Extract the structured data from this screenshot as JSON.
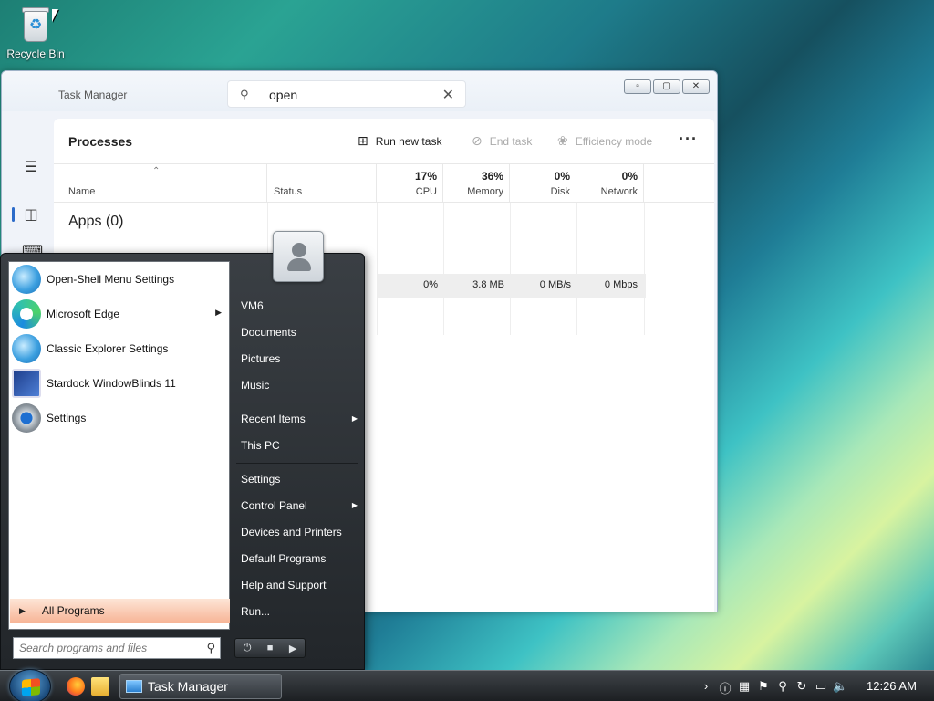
{
  "desktop": {
    "recycle_bin_label": "Recycle Bin"
  },
  "task_manager": {
    "title": "Task Manager",
    "search": {
      "value": "open"
    },
    "section_title": "Processes",
    "toolbar": {
      "run_new_task": "Run new task",
      "end_task": "End task",
      "efficiency_mode": "Efficiency mode"
    },
    "columns": {
      "name": "Name",
      "status": "Status",
      "cpu": {
        "pct": "17%",
        "label": "CPU"
      },
      "memory": {
        "pct": "36%",
        "label": "Memory"
      },
      "disk": {
        "pct": "0%",
        "label": "Disk"
      },
      "network": {
        "pct": "0%",
        "label": "Network"
      }
    },
    "apps_group": "Apps (0)",
    "row": {
      "cpu": "0%",
      "memory": "3.8 MB",
      "disk": "0 MB/s",
      "network": "0 Mbps"
    }
  },
  "start_menu": {
    "pinned": [
      {
        "label": "Open-Shell Menu Settings",
        "icon": "shell-icon"
      },
      {
        "label": "Microsoft Edge",
        "icon": "edge-icon",
        "has_submenu": true
      },
      {
        "label": "Classic Explorer Settings",
        "icon": "shell-icon"
      },
      {
        "label": "Stardock WindowBlinds 11",
        "icon": "windowblinds-icon"
      },
      {
        "label": "Settings",
        "icon": "gear-icon"
      }
    ],
    "all_programs": "All Programs",
    "search_placeholder": "Search programs and files",
    "right": [
      {
        "label": "VM6"
      },
      {
        "label": "Documents"
      },
      {
        "label": "Pictures"
      },
      {
        "label": "Music"
      },
      {
        "label": "Recent Items",
        "has_submenu": true
      },
      {
        "label": "This PC"
      },
      {
        "label": "Settings"
      },
      {
        "label": "Control Panel",
        "has_submenu": true
      },
      {
        "label": "Devices and Printers"
      },
      {
        "label": "Default Programs"
      },
      {
        "label": "Help and Support"
      },
      {
        "label": "Run..."
      }
    ]
  },
  "taskbar": {
    "task_label": "Task Manager",
    "clock": "12:26 AM"
  }
}
